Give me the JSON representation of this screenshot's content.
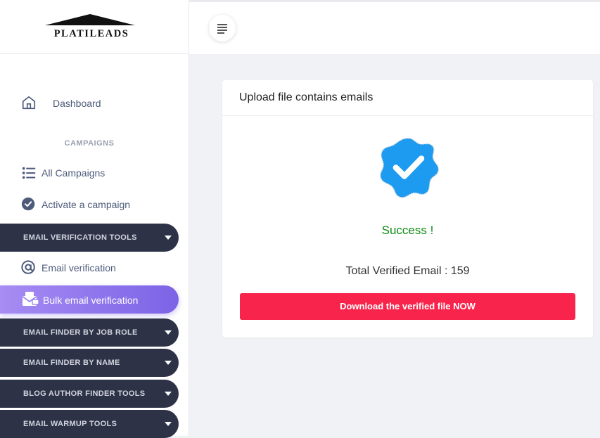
{
  "brand": {
    "name": "PLATILEADS"
  },
  "sidebar": {
    "dashboard_label": "Dashboard",
    "section_campaigns": "CAMPAIGNS",
    "all_campaigns_label": "All Campaigns",
    "activate_campaign_label": "Activate a campaign",
    "email_verification_tools": "EMAIL VERIFICATION TOOLS",
    "email_verification_label": "Email verification",
    "bulk_email_verification_label": "Bulk email verification",
    "email_finder_job_role": "EMAIL FINDER BY JOB ROLE",
    "email_finder_name": "EMAIL FINDER BY NAME",
    "blog_author_finder": "BLOG AUTHOR FINDER TOOLS",
    "email_warmup": "EMAIL WARMUP TOOLS"
  },
  "card": {
    "title": "Upload file contains emails",
    "status_text": "Success !",
    "total_label": "Total Verified Email :",
    "total_value": "159",
    "download_label": "Download the verified file NOW"
  },
  "icons": {
    "menu": "menu-icon",
    "dashboard": "home-icon",
    "all_campaigns": "list-icon",
    "activate": "check-circle-icon",
    "email_verification": "at-icon",
    "bulk": "mail-stack-icon",
    "dropdown": "caret-down-icon",
    "verified": "verified-badge-icon"
  },
  "colors": {
    "accent_purple": "#7b63e6",
    "sidebar_dark": "#2e3247",
    "success_green": "#118a16",
    "download_red": "#f8244b",
    "badge_blue": "#1d9bf0"
  }
}
